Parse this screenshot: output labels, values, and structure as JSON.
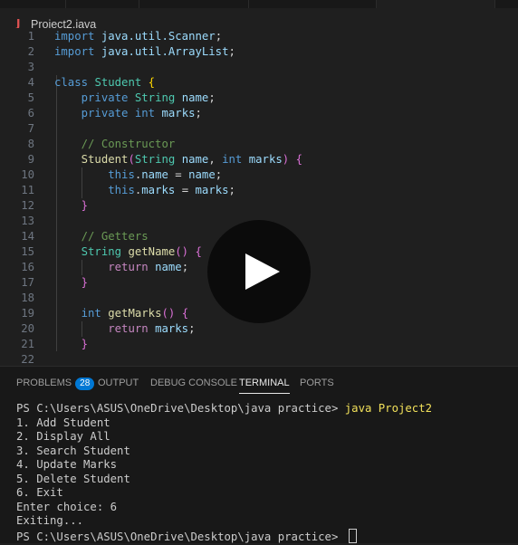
{
  "editor": {
    "filename": "Project2.java",
    "file_icon": "J",
    "lines": [
      {
        "n": "1",
        "t": [
          [
            "kw",
            "import"
          ],
          [
            "pl",
            " "
          ],
          [
            "id",
            "java.util.Scanner"
          ],
          [
            "pl",
            ";"
          ]
        ]
      },
      {
        "n": "2",
        "t": [
          [
            "kw",
            "import"
          ],
          [
            "pl",
            " "
          ],
          [
            "id",
            "java.util.ArrayList"
          ],
          [
            "pl",
            ";"
          ]
        ]
      },
      {
        "n": "3",
        "t": []
      },
      {
        "n": "4",
        "t": [
          [
            "kw",
            "class"
          ],
          [
            "pl",
            " "
          ],
          [
            "ty",
            "Student"
          ],
          [
            "pl",
            " "
          ],
          [
            "br",
            "{"
          ]
        ]
      },
      {
        "n": "5",
        "t": [
          [
            "pl",
            "    "
          ],
          [
            "kw",
            "private"
          ],
          [
            "pl",
            " "
          ],
          [
            "ty",
            "String"
          ],
          [
            "pl",
            " "
          ],
          [
            "id",
            "name"
          ],
          [
            "pl",
            ";"
          ]
        ]
      },
      {
        "n": "6",
        "t": [
          [
            "pl",
            "    "
          ],
          [
            "kw",
            "private"
          ],
          [
            "pl",
            " "
          ],
          [
            "kw",
            "int"
          ],
          [
            "pl",
            " "
          ],
          [
            "id",
            "marks"
          ],
          [
            "pl",
            ";"
          ]
        ]
      },
      {
        "n": "7",
        "t": []
      },
      {
        "n": "8",
        "t": [
          [
            "pl",
            "    "
          ],
          [
            "cm",
            "// Constructor"
          ]
        ]
      },
      {
        "n": "9",
        "t": [
          [
            "pl",
            "    "
          ],
          [
            "fn",
            "Student"
          ],
          [
            "br2",
            "("
          ],
          [
            "ty",
            "String"
          ],
          [
            "pl",
            " "
          ],
          [
            "id",
            "name"
          ],
          [
            "pl",
            ", "
          ],
          [
            "kw",
            "int"
          ],
          [
            "pl",
            " "
          ],
          [
            "id",
            "marks"
          ],
          [
            "br2",
            ")"
          ],
          [
            "pl",
            " "
          ],
          [
            "br2",
            "{"
          ]
        ]
      },
      {
        "n": "10",
        "t": [
          [
            "pl",
            "        "
          ],
          [
            "kw",
            "this"
          ],
          [
            "pl",
            "."
          ],
          [
            "id",
            "name"
          ],
          [
            "pl",
            " = "
          ],
          [
            "id",
            "name"
          ],
          [
            "pl",
            ";"
          ]
        ]
      },
      {
        "n": "11",
        "t": [
          [
            "pl",
            "        "
          ],
          [
            "kw",
            "this"
          ],
          [
            "pl",
            "."
          ],
          [
            "id",
            "marks"
          ],
          [
            "pl",
            " = "
          ],
          [
            "id",
            "marks"
          ],
          [
            "pl",
            ";"
          ]
        ]
      },
      {
        "n": "12",
        "t": [
          [
            "pl",
            "    "
          ],
          [
            "br2",
            "}"
          ]
        ]
      },
      {
        "n": "13",
        "t": []
      },
      {
        "n": "14",
        "t": [
          [
            "pl",
            "    "
          ],
          [
            "cm",
            "// Getters"
          ]
        ]
      },
      {
        "n": "15",
        "t": [
          [
            "pl",
            "    "
          ],
          [
            "ty",
            "String"
          ],
          [
            "pl",
            " "
          ],
          [
            "fn",
            "getName"
          ],
          [
            "br2",
            "()"
          ],
          [
            "pl",
            " "
          ],
          [
            "br2",
            "{"
          ]
        ]
      },
      {
        "n": "16",
        "t": [
          [
            "pl",
            "        "
          ],
          [
            "ctl",
            "return"
          ],
          [
            "pl",
            " "
          ],
          [
            "id",
            "name"
          ],
          [
            "pl",
            ";"
          ]
        ]
      },
      {
        "n": "17",
        "t": [
          [
            "pl",
            "    "
          ],
          [
            "br2",
            "}"
          ]
        ]
      },
      {
        "n": "18",
        "t": []
      },
      {
        "n": "19",
        "t": [
          [
            "pl",
            "    "
          ],
          [
            "kw",
            "int"
          ],
          [
            "pl",
            " "
          ],
          [
            "fn",
            "getMarks"
          ],
          [
            "br2",
            "()"
          ],
          [
            "pl",
            " "
          ],
          [
            "br2",
            "{"
          ]
        ]
      },
      {
        "n": "20",
        "t": [
          [
            "pl",
            "        "
          ],
          [
            "ctl",
            "return"
          ],
          [
            "pl",
            " "
          ],
          [
            "id",
            "marks"
          ],
          [
            "pl",
            ";"
          ]
        ]
      },
      {
        "n": "21",
        "t": [
          [
            "pl",
            "    "
          ],
          [
            "br2",
            "}"
          ]
        ]
      },
      {
        "n": "22",
        "t": []
      }
    ]
  },
  "panel": {
    "tabs": [
      {
        "label": "PROBLEMS",
        "badge": "28",
        "active": false
      },
      {
        "label": "OUTPUT",
        "active": false
      },
      {
        "label": "DEBUG CONSOLE",
        "active": false
      },
      {
        "label": "TERMINAL",
        "active": true
      },
      {
        "label": "PORTS",
        "active": false
      }
    ]
  },
  "terminal": {
    "prompt_1": "PS C:\\Users\\ASUS\\OneDrive\\Desktop\\java practice> ",
    "command": "java Project2",
    "output": [
      "1. Add Student",
      "2. Display All",
      "3. Search Student",
      "4. Update Marks",
      "5. Delete Student",
      "6. Exit",
      "Enter choice: 6",
      "Exiting..."
    ],
    "prompt_2": "PS C:\\Users\\ASUS\\OneDrive\\Desktop\\java practice> "
  },
  "overlay": {
    "icon": "play-icon"
  },
  "colors": {
    "editor_bg": "#1f1f1f",
    "panel_bg": "#181818",
    "accent": "#0078d4",
    "command": "#f1e05a",
    "java_icon": "#e05252"
  }
}
